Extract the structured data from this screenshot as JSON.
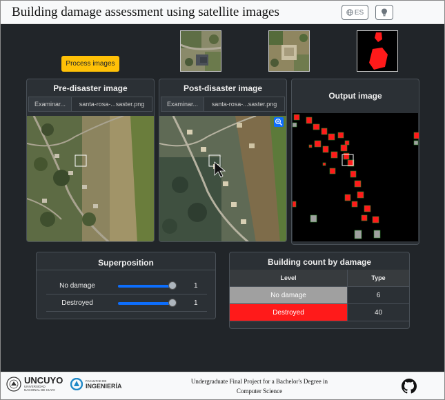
{
  "header": {
    "title": "Building damage assessment using satellite images",
    "language_label": "ES",
    "globe_icon": "globe-icon",
    "hint_icon": "lightbulb-icon"
  },
  "process_button": "Process images",
  "panels": {
    "pre": {
      "title": "Pre-disaster image",
      "browse_label": "Examinar...",
      "file_name": "santa-rosa-...saster.png"
    },
    "post": {
      "title": "Post-disaster image",
      "browse_label": "Examinar...",
      "file_name": "santa-rosa-...saster.png",
      "zoom_icon": "zoom-in-icon"
    },
    "output": {
      "title": "Output image"
    }
  },
  "superposition": {
    "title": "Superposition",
    "rows": [
      {
        "label": "No damage",
        "value": "1",
        "level": 1
      },
      {
        "label": "Destroyed",
        "value": "1",
        "level": 1
      }
    ]
  },
  "building_count": {
    "title": "Building count by damage",
    "columns": [
      "Level",
      "Type"
    ],
    "rows": [
      {
        "level": "No damage",
        "count": "6",
        "color": "#a0a0a0"
      },
      {
        "level": "Destroyed",
        "count": "40",
        "color": "#ff1a1a"
      }
    ]
  },
  "footer": {
    "university": "UNCUYO",
    "university_sub1": "UNIVERSIDAD",
    "university_sub2": "NACIONAL DE CUYO",
    "faculty_sub": "FACULTAD DE",
    "faculty": "INGENIERÍA",
    "line1": "Undergraduate Final Project for a Bachelor's Degree in",
    "line2": "Computer Science",
    "github_icon": "github-icon"
  },
  "colors": {
    "accent": "#ffc107",
    "slider": "#0d6efd",
    "destroyed": "#ff1a1a",
    "no_damage": "#a0a0a0",
    "background": "#212529"
  }
}
